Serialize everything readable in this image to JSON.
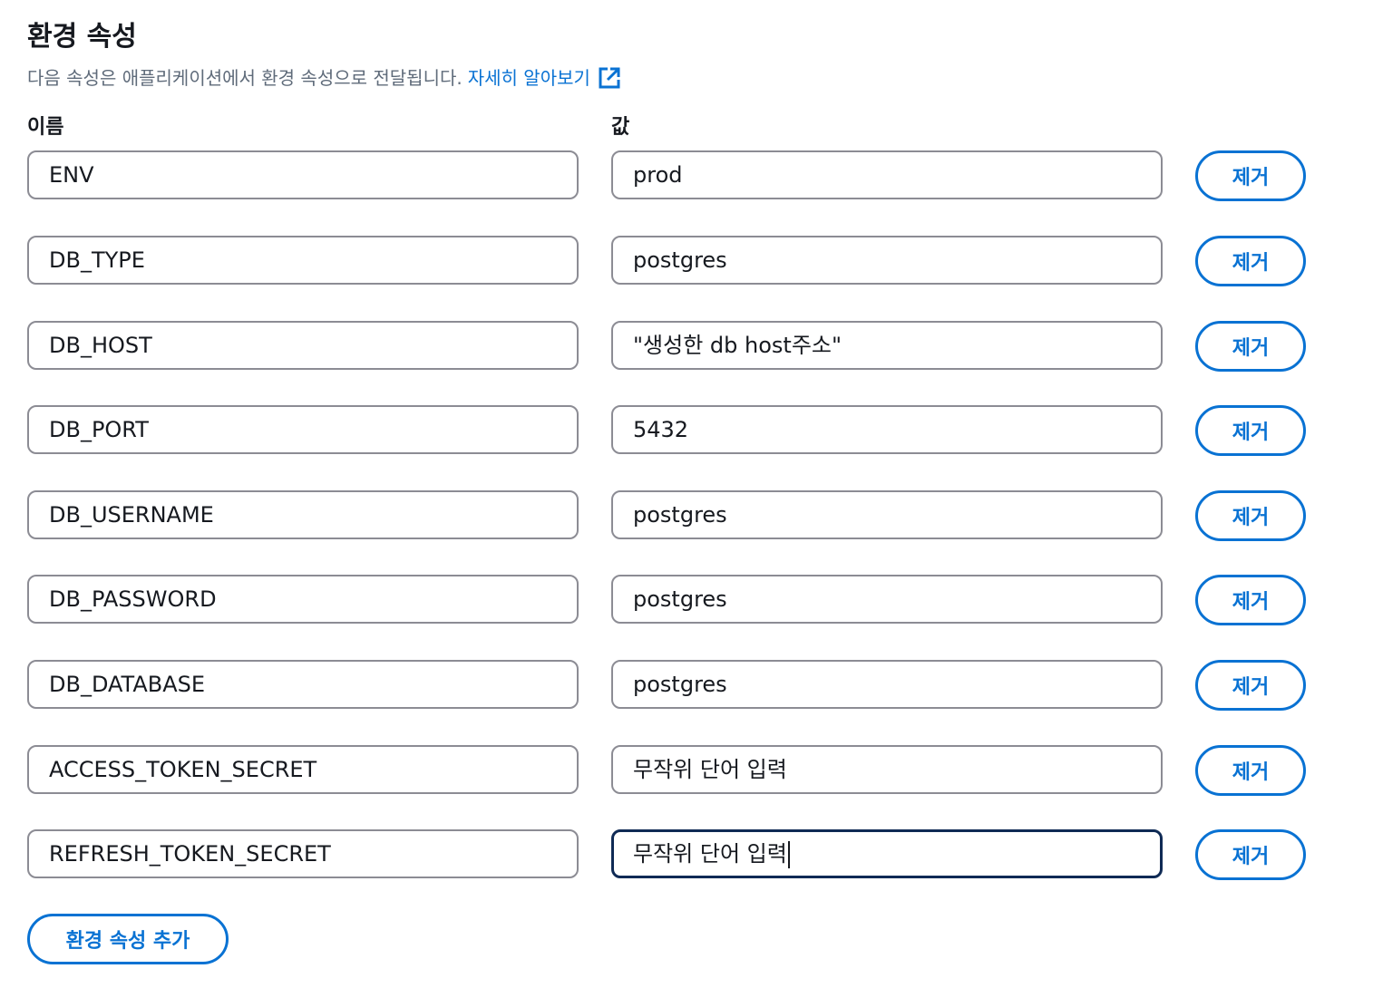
{
  "section": {
    "title": "환경 속성",
    "description": "다음 속성은 애플리케이션에서 환경 속성으로 전달됩니다.",
    "learn_more": "자세히 알아보기",
    "learn_more_icon": "external-link-icon"
  },
  "columns": {
    "name": "이름",
    "value": "값"
  },
  "remove_label": "제거",
  "add_label": "환경 속성 추가",
  "rows": [
    {
      "name": "ENV",
      "value": "prod"
    },
    {
      "name": "DB_TYPE",
      "value": "postgres"
    },
    {
      "name": "DB_HOST",
      "value": "\"생성한 db host주소\""
    },
    {
      "name": "DB_PORT",
      "value": "5432"
    },
    {
      "name": "DB_USERNAME",
      "value": "postgres"
    },
    {
      "name": "DB_PASSWORD",
      "value": "postgres"
    },
    {
      "name": "DB_DATABASE",
      "value": "postgres"
    },
    {
      "name": "ACCESS_TOKEN_SECRET",
      "value": "무작위 단어 입력"
    },
    {
      "name": "REFRESH_TOKEN_SECRET",
      "value": "무작위 단어 입력"
    }
  ],
  "colors": {
    "accent": "#0972d3",
    "focus_border": "#0f2a55",
    "input_border": "#8c8c94",
    "muted_text": "#5f6b7a"
  }
}
